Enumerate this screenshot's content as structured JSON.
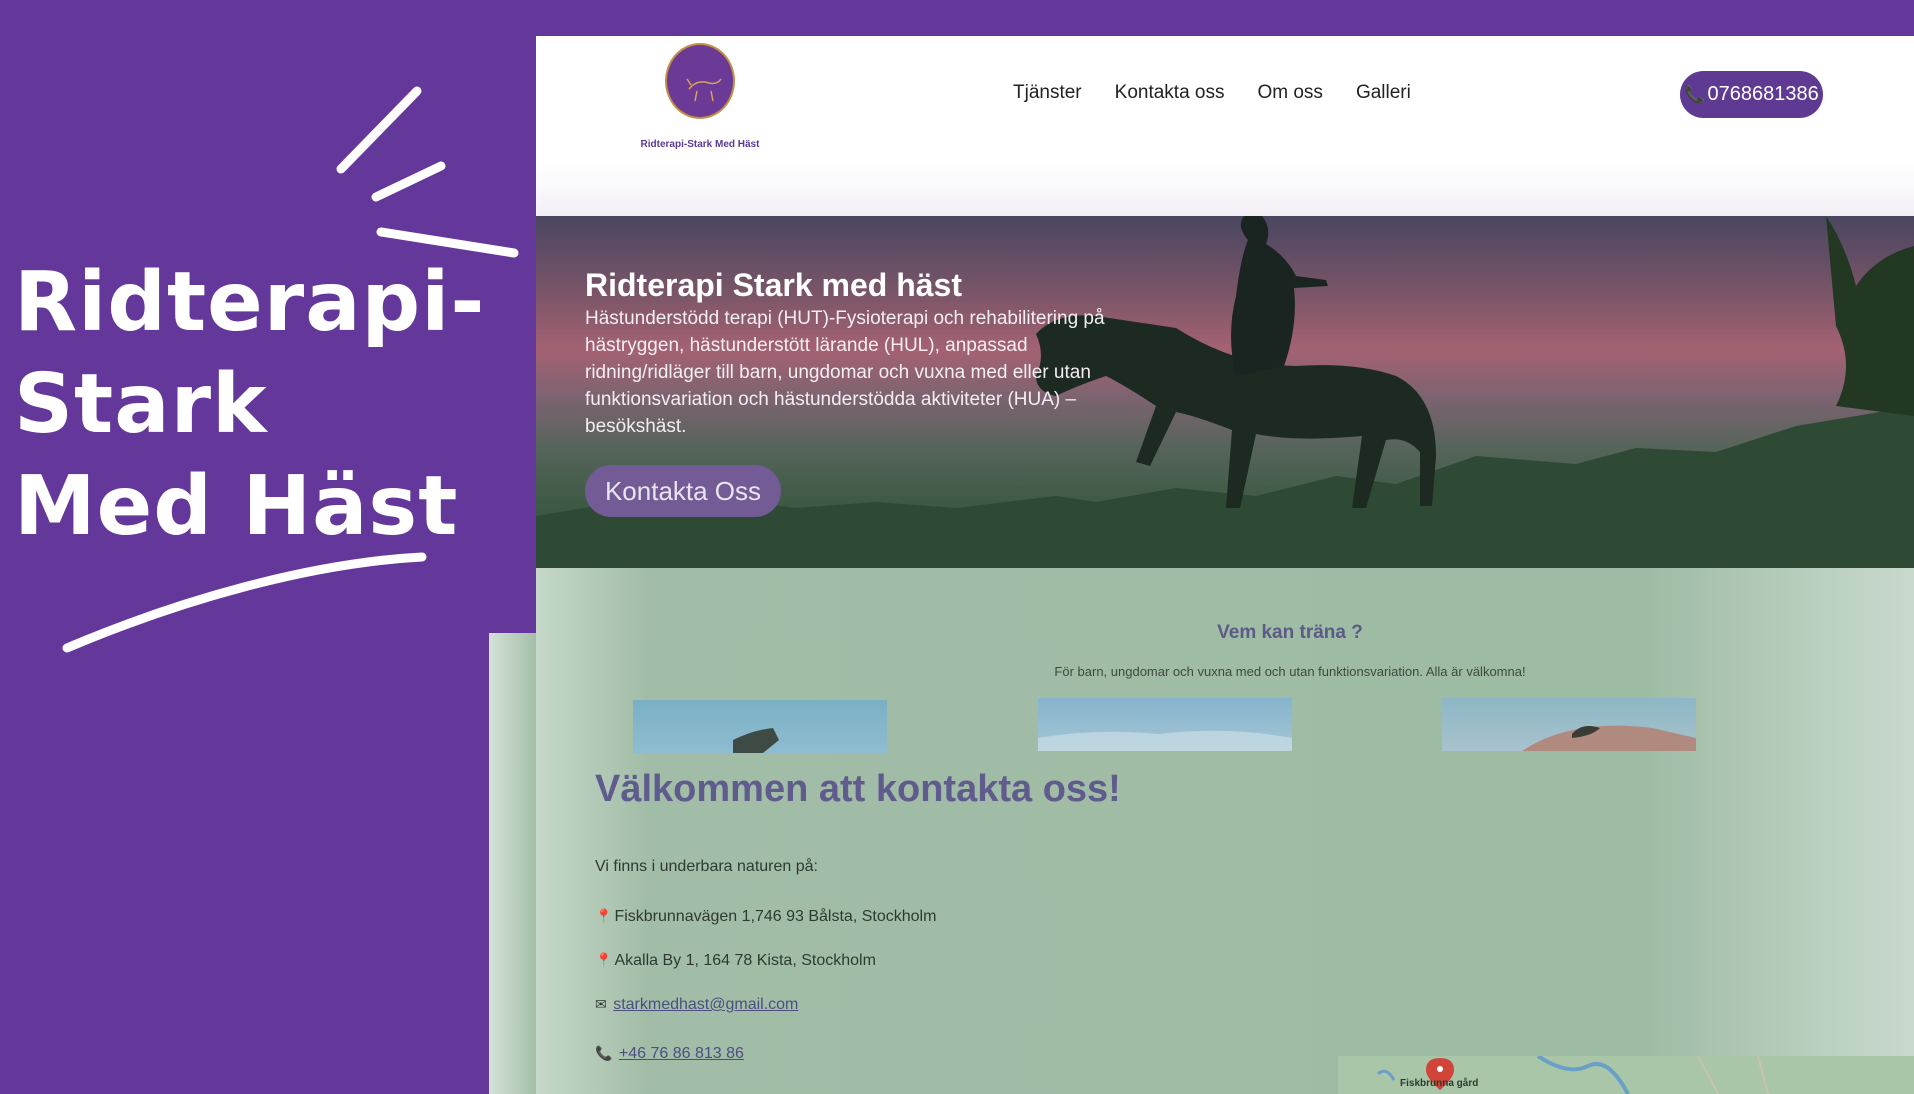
{
  "promo": {
    "title_line1": "Ridterapi-",
    "title_line2": "Stark",
    "title_line3": "Med Häst"
  },
  "header": {
    "logo_text": "Ridterapi-Stark Med Häst",
    "nav": [
      "Tjänster",
      "Kontakta oss",
      "Om oss",
      "Galleri"
    ],
    "phone_icon": "phone-icon",
    "phone_label": "0768681386"
  },
  "hero": {
    "title": "Ridterapi Stark med häst",
    "text": "Hästunderstödd terapi (HUT)-Fysioterapi och rehabilitering på hästryggen, hästunderstött lärande (HUL), anpassad ridning/ridläger till barn, ungdomar och vuxna med eller utan funktionsvariation och hästunderstödda aktiviteter (HUA) – besökshäst.",
    "button_label": "Kontakta Oss"
  },
  "who": {
    "title": "Vem kan träna ?",
    "subtitle": "För barn, ungdomar och vuxna med och utan funktionsvariation. Alla är välkomna!"
  },
  "contact": {
    "title": "Välkommen att kontakta oss!",
    "intro": "Vi finns i underbara naturen på:",
    "address1": "Fiskbrunnavägen 1,746 93 Bålsta, Stockholm",
    "address2": "Akalla By 1, 164 78 Kista, Stockholm",
    "email": "starkmedhast@gmail.com",
    "phone": "+46 76 86 813 86"
  },
  "map": {
    "place_label": "Fiskbrunna gård"
  },
  "colors": {
    "brand_purple": "#64379a",
    "button_purple": "#5f3a93",
    "heading_purple": "#605b8d"
  }
}
